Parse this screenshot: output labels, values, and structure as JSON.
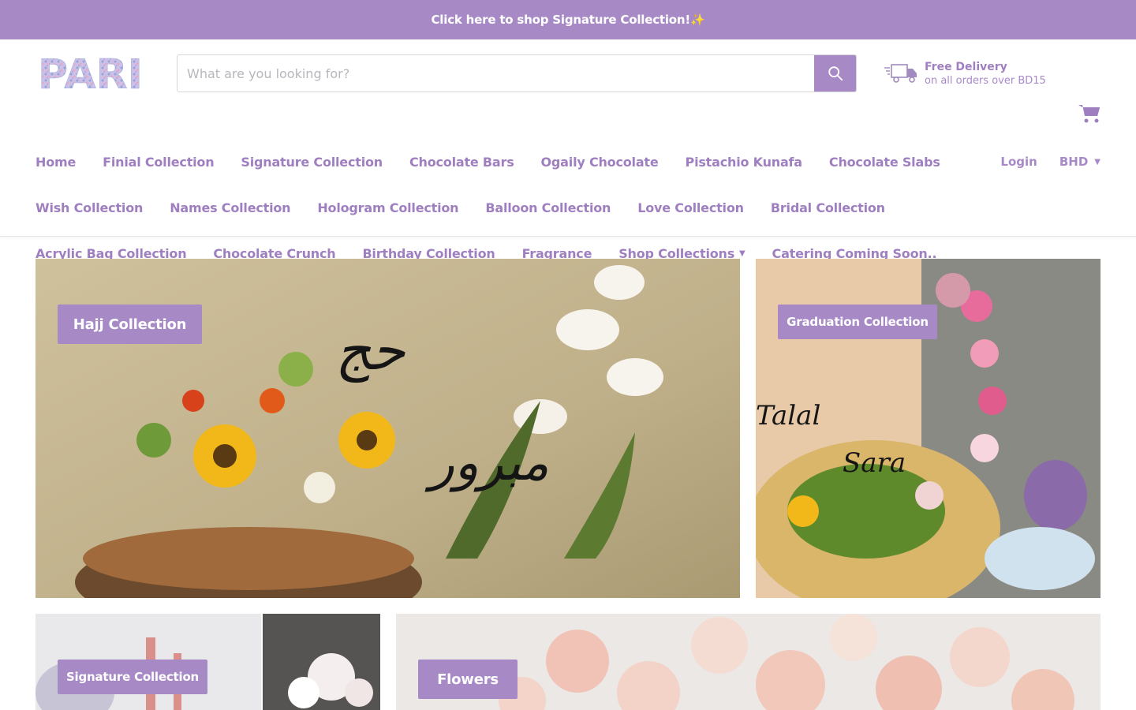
{
  "announcement": {
    "text": "Click here to shop Signature Collection!✨"
  },
  "header": {
    "logo": "PARI",
    "search": {
      "placeholder": "What are you looking for?",
      "value": ""
    },
    "delivery": {
      "title": "Free Delivery",
      "subtitle": "on all orders over BD15"
    },
    "icons": {
      "search": "search-icon",
      "truck": "truck-icon",
      "cart": "cart-icon"
    }
  },
  "nav": {
    "row1": [
      "Home",
      "Finial Collection",
      "Signature Collection",
      "Chocolate Bars",
      "Ogaily Chocolate",
      "Pistachio Kunafa",
      "Chocolate Slabs"
    ],
    "row2": [
      "Wish Collection",
      "Names Collection",
      "Hologram Collection",
      "Balloon Collection",
      "Love Collection",
      "Bridal Collection"
    ],
    "row3": [
      "Acrylic Bag Collection",
      "Chocolate Crunch",
      "Birthday Collection",
      "Fragrance",
      "Shop Collections",
      "Catering Coming Soon.."
    ],
    "login": "Login",
    "currency": "BHD"
  },
  "promos": {
    "hajj": "Hajj Collection",
    "graduation": "Graduation Collection",
    "signature": "Signature Collection",
    "flowers": "Flowers"
  },
  "colors": {
    "brand": "#a789c6",
    "nav_text": "#9f7fc0"
  }
}
